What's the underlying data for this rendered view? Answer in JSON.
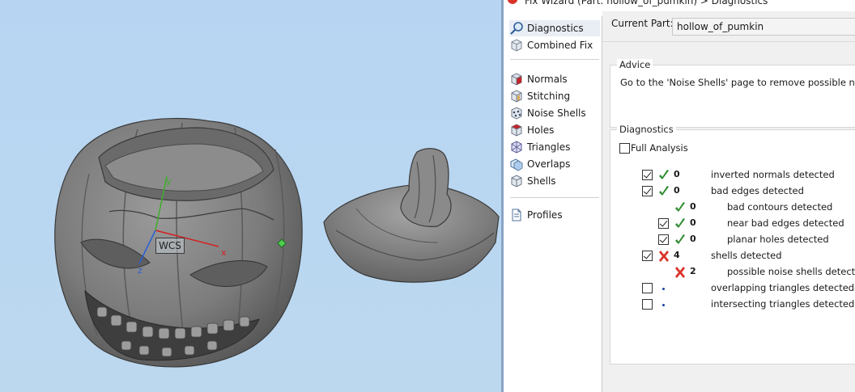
{
  "window": {
    "title": "Fix Wizard (Part: hollow_of_pumkin) > Diagnostics",
    "title_icon": "red-wizard-icon"
  },
  "viewport": {
    "wcs_label": "WCS",
    "axes": {
      "x": "x",
      "y": "y",
      "z": "z"
    }
  },
  "nav": {
    "items": [
      {
        "label": "Diagnostics",
        "icon": "magnifier-icon",
        "active": true
      },
      {
        "label": "Combined Fix",
        "icon": "cube-icon"
      },
      {
        "label": "Normals",
        "icon": "normals-cube-icon"
      },
      {
        "label": "Stitching",
        "icon": "stitching-cube-icon"
      },
      {
        "label": "Noise Shells",
        "icon": "noise-shells-icon"
      },
      {
        "label": "Holes",
        "icon": "holes-cube-icon"
      },
      {
        "label": "Triangles",
        "icon": "triangles-icon"
      },
      {
        "label": "Overlaps",
        "icon": "overlaps-icon"
      },
      {
        "label": "Shells",
        "icon": "shells-icon"
      },
      {
        "label": "Profiles",
        "icon": "document-icon"
      }
    ]
  },
  "current_part": {
    "label": "Current Part:",
    "value": "hollow_of_pumkin"
  },
  "advice": {
    "legend": "Advice",
    "text": "Go to the 'Noise Shells' page to remove possible noise"
  },
  "diagnostics": {
    "legend": "Diagnostics",
    "full_analysis_label": "Full Analysis",
    "full_analysis_checked": false,
    "rows": [
      {
        "checked": true,
        "status": "ok",
        "count": "0",
        "label": "inverted normals detected"
      },
      {
        "checked": true,
        "status": "ok",
        "count": "0",
        "label": "bad edges detected"
      },
      {
        "checked": null,
        "status": "ok",
        "count": "0",
        "label": "bad contours detected"
      },
      {
        "checked": true,
        "status": "ok",
        "count": "0",
        "label": "near bad edges detected"
      },
      {
        "checked": true,
        "status": "ok",
        "count": "0",
        "label": "planar holes detected"
      },
      {
        "checked": true,
        "status": "error",
        "count": "4",
        "label": "shells detected"
      },
      {
        "checked": null,
        "status": "error",
        "count": "2",
        "label": "possible noise shells detected"
      },
      {
        "checked": false,
        "status": "none",
        "count": "",
        "label": "overlapping triangles detected"
      },
      {
        "checked": false,
        "status": "none",
        "count": "",
        "label": "intersecting triangles detected"
      }
    ]
  },
  "colors": {
    "ok": "#2e8b2e",
    "error": "#d9342b",
    "viewport_bg": "#b9d6f0",
    "axis_x": "#d42020",
    "axis_y": "#3fae2a",
    "axis_z": "#2a5fd4"
  }
}
